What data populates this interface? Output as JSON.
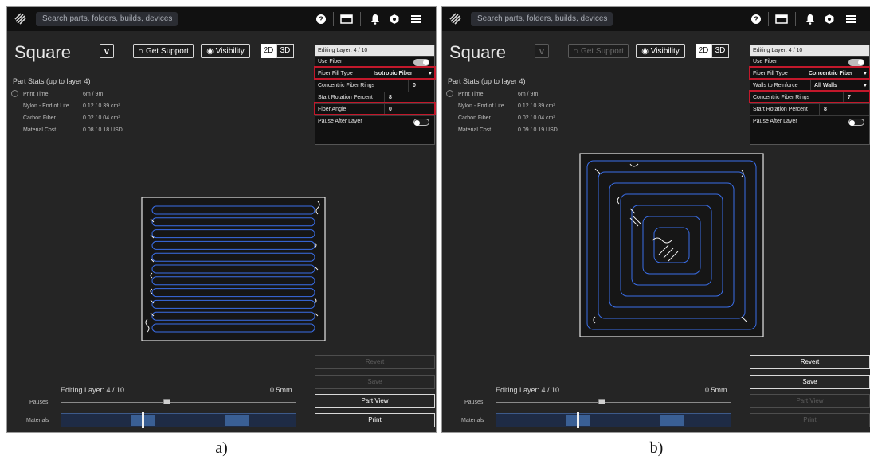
{
  "panels": [
    {
      "caption": "a)",
      "search_placeholder": "Search parts, folders, builds, devices",
      "part_title": "Square",
      "get_support_label": "Get Support",
      "visibility_label": "Visibility",
      "view_2d": "2D",
      "view_3d": "3D",
      "stats": {
        "header": "Part Stats (up to layer 4)",
        "rows": [
          {
            "label": "Print Time",
            "value": "6m / 9m"
          },
          {
            "label": "Nylon - End of Life",
            "value": "0.12 / 0.39 cm³"
          },
          {
            "label": "Carbon Fiber",
            "value": "0.02 / 0.04 cm³"
          },
          {
            "label": "Material Cost",
            "value": "0.08 / 0.18 USD"
          }
        ]
      },
      "layer_panel": {
        "header": "Editing Layer: 4 / 10",
        "use_fiber": "Use Fiber",
        "fill_type_label": "Fiber Fill Type",
        "fill_type_value": "Isotropic Fiber",
        "rings_label": "Concentric Fiber Rings",
        "rings_value": "0",
        "rotation_label": "Start Rotation Percent",
        "rotation_value": "8",
        "angle_label": "Fiber Angle",
        "angle_value": "0",
        "pause_label": "Pause After Layer"
      },
      "actions": {
        "revert": "Revert",
        "save": "Save",
        "part_view": "Part View",
        "print": "Print"
      },
      "bottom": {
        "editing_layer": "Editing Layer: 4 / 10",
        "thickness": "0.5mm",
        "pauses": "Pauses",
        "materials": "Materials"
      }
    },
    {
      "caption": "b)",
      "search_placeholder": "Search parts, folders, builds, devices",
      "part_title": "Square",
      "get_support_label": "Get Support",
      "visibility_label": "Visibility",
      "view_2d": "2D",
      "view_3d": "3D",
      "stats": {
        "header": "Part Stats (up to layer 4)",
        "rows": [
          {
            "label": "Print Time",
            "value": "6m / 9m"
          },
          {
            "label": "Nylon - End of Life",
            "value": "0.12 / 0.39 cm³"
          },
          {
            "label": "Carbon Fiber",
            "value": "0.02 / 0.04 cm³"
          },
          {
            "label": "Material Cost",
            "value": "0.09 / 0.19 USD"
          }
        ]
      },
      "layer_panel": {
        "header": "Editing Layer: 4 / 10",
        "use_fiber": "Use Fiber",
        "fill_type_label": "Fiber Fill Type",
        "fill_type_value": "Concentric Fiber",
        "walls_label": "Walls to Reinforce",
        "walls_value": "All Walls",
        "rings_label": "Concentric Fiber Rings",
        "rings_value": "7",
        "rotation_label": "Start Rotation Percent",
        "rotation_value": "8",
        "pause_label": "Pause After Layer"
      },
      "actions": {
        "revert": "Revert",
        "save": "Save",
        "part_view": "Part View",
        "print": "Print"
      },
      "bottom": {
        "editing_layer": "Editing Layer: 4 / 10",
        "thickness": "0.5mm",
        "pauses": "Pauses",
        "materials": "Materials"
      }
    }
  ],
  "colors": {
    "highlight": "#c2182b",
    "fiber_path": "#3a6ee8",
    "material_bar": "#3a5f94"
  },
  "icons": [
    "logo-icon",
    "help-icon",
    "window-icon",
    "bell-icon",
    "hexagon-icon",
    "menu-icon",
    "clock-icon",
    "headset-icon",
    "eye-icon"
  ]
}
